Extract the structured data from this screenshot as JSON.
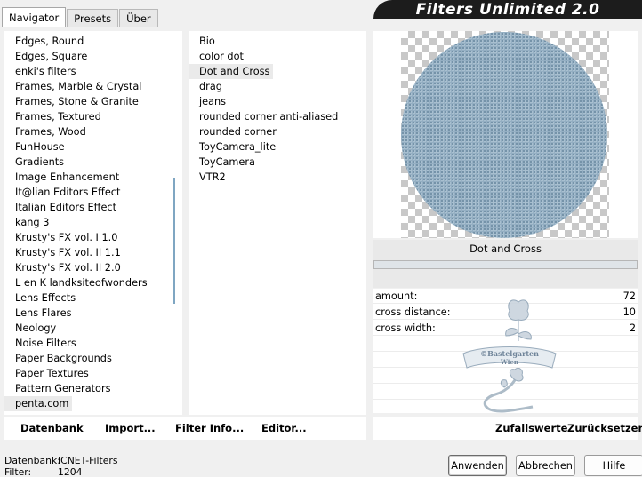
{
  "title": "Filters Unlimited 2.0",
  "tabs": [
    {
      "label": "Navigator",
      "active": true
    },
    {
      "label": "Presets",
      "active": false
    },
    {
      "label": "Über",
      "active": false
    }
  ],
  "categories": [
    "Edges, Round",
    "Edges, Square",
    "enki's filters",
    "Frames, Marble & Crystal",
    "Frames, Stone & Granite",
    "Frames, Textured",
    "Frames, Wood",
    "FunHouse",
    "Gradients",
    "Image Enhancement",
    "It@lian Editors Effect",
    "Italian Editors Effect",
    "kang 3",
    "Krusty's FX vol. I 1.0",
    "Krusty's FX vol. II 1.1",
    "Krusty's FX vol. II 2.0",
    "L en K landksiteofwonders",
    "Lens Effects",
    "Lens Flares",
    "Neology",
    "Noise Filters",
    "Paper Backgrounds",
    "Paper Textures",
    "Pattern Generators",
    "penta.com"
  ],
  "selected_category": "penta.com",
  "filters": [
    "Bio",
    "color dot",
    "Dot and Cross",
    "drag",
    "jeans",
    "rounded corner anti-aliased",
    "rounded corner",
    "ToyCamera_lite",
    "ToyCamera",
    "VTR2"
  ],
  "selected_filter": "Dot and Cross",
  "preview_filter_name": "Dot and Cross",
  "params": [
    {
      "label": "amount:",
      "value": "72"
    },
    {
      "label": "cross distance:",
      "value": "10"
    },
    {
      "label": "cross width:",
      "value": "2"
    }
  ],
  "watermark_text": [
    "©Bastelgarten",
    "Wien"
  ],
  "left_buttons": {
    "database": {
      "underlined": "D",
      "rest": "atenbank"
    },
    "import": {
      "underlined": "I",
      "rest": "mport..."
    },
    "filter_info": {
      "underlined": "F",
      "rest": "ilter Info..."
    },
    "editor": {
      "underlined": "E",
      "rest": "ditor..."
    }
  },
  "right_buttons": {
    "random": "Zufallswerte",
    "reset": "Zurücksetzen"
  },
  "footer": {
    "database_label": "Datenbank:",
    "database_value": "ICNET-Filters",
    "filter_label": "Filter:",
    "filter_value": "1204"
  },
  "dialog_buttons": {
    "apply": "Anwenden",
    "cancel": "Abbrechen",
    "help": "Hilfe"
  },
  "colors": {
    "title_bg": "#1c1c1c",
    "preview_circle": "#a9c0d0",
    "scroll_thumb": "#7fa6c2"
  }
}
